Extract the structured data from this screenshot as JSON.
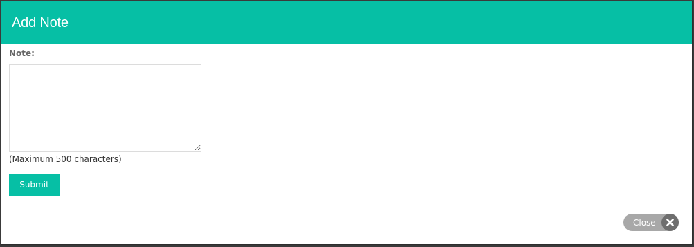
{
  "modal": {
    "title": "Add Note",
    "note_label": "Note:",
    "note_value": "",
    "max_hint": "(Maximum 500 characters)",
    "submit_label": "Submit",
    "close_label": "Close",
    "close_icon": "times-icon"
  },
  "colors": {
    "accent": "#06bfa5",
    "close_pill": "#a8a8a8",
    "close_icon_bg": "#6e6e6e"
  }
}
